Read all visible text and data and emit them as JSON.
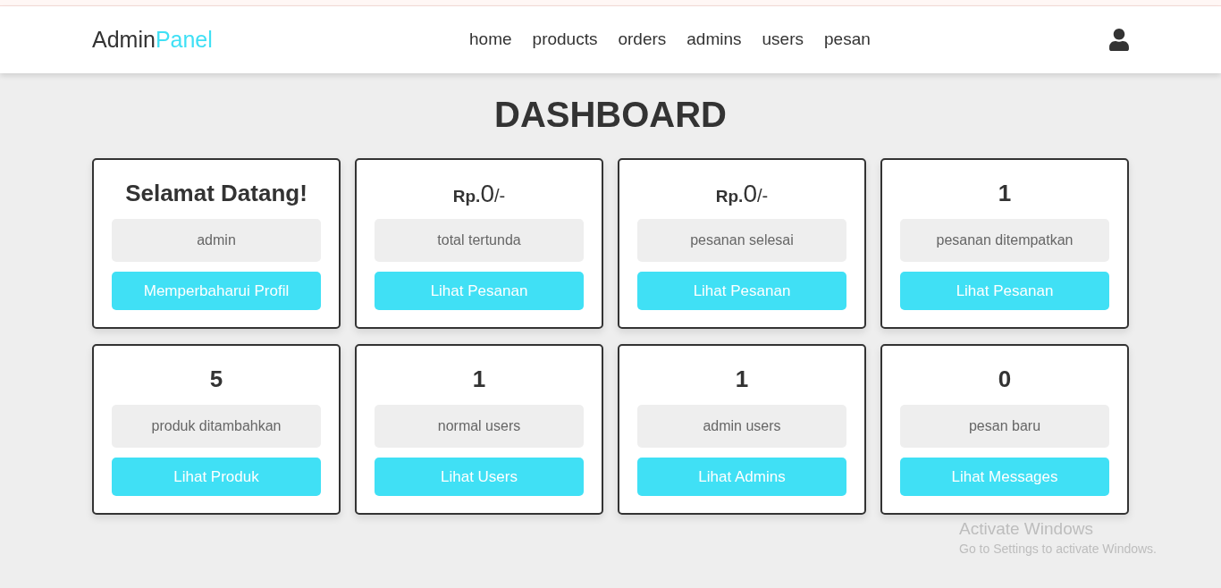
{
  "header": {
    "brand": {
      "first": "Admin",
      "second": "Panel"
    },
    "nav": [
      "home",
      "products",
      "orders",
      "admins",
      "users",
      "pesan"
    ]
  },
  "title": "DASHBOARD",
  "cards": [
    {
      "kind": "text",
      "heading": "Selamat Datang!",
      "label": "admin",
      "button": "Memperbaharui Profil"
    },
    {
      "kind": "amount",
      "currency": "Rp.",
      "amount": "0",
      "suffix": "/-",
      "label": "total tertunda",
      "button": "Lihat Pesanan"
    },
    {
      "kind": "amount",
      "currency": "Rp.",
      "amount": "0",
      "suffix": "/-",
      "label": "pesanan selesai",
      "button": "Lihat Pesanan"
    },
    {
      "kind": "text",
      "heading": "1",
      "label": "pesanan ditempatkan",
      "button": "Lihat Pesanan"
    },
    {
      "kind": "text",
      "heading": "5",
      "label": "produk ditambahkan",
      "button": "Lihat Produk"
    },
    {
      "kind": "text",
      "heading": "1",
      "label": "normal users",
      "button": "Lihat Users"
    },
    {
      "kind": "text",
      "heading": "1",
      "label": "admin users",
      "button": "Lihat Admins"
    },
    {
      "kind": "text",
      "heading": "0",
      "label": "pesan baru",
      "button": "Lihat Messages"
    }
  ],
  "activation_notice": {
    "title": "Activate Windows",
    "message": "Go to Settings to activate Windows."
  }
}
